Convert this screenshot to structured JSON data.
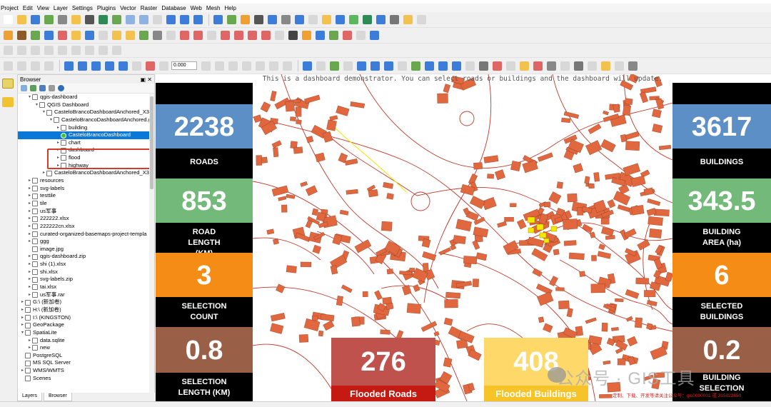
{
  "menu": [
    "Project",
    "Edit",
    "View",
    "Layer",
    "Settings",
    "Plugins",
    "Vector",
    "Raster",
    "Database",
    "Web",
    "Mesh",
    "Help"
  ],
  "toolbar": {
    "scale_value": "0.000"
  },
  "browser": {
    "title": "Browser",
    "tabs": [
      "Layers",
      "Browser"
    ],
    "tree": [
      {
        "label": "qgis-dashboard",
        "depth": 1,
        "arrow": "▾"
      },
      {
        "label": "QGIS Dashboard",
        "depth": 2,
        "arrow": "▾"
      },
      {
        "label": "CasteloBrancoDashboardAnchored_X3U",
        "depth": 3,
        "arrow": "▾"
      },
      {
        "label": "CasteloBrancoDashboardAnchored.g",
        "depth": 4,
        "arrow": "▾"
      },
      {
        "label": "building",
        "depth": 5,
        "arrow": "▸"
      },
      {
        "label": "CasteloBrancoDashboard",
        "depth": 5,
        "arrow": "",
        "selected": true
      },
      {
        "label": "chart",
        "depth": 5,
        "arrow": "▸"
      },
      {
        "label": "dashboard",
        "depth": 5,
        "arrow": "▸"
      },
      {
        "label": "flood",
        "depth": 5,
        "arrow": "▸"
      },
      {
        "label": "highway",
        "depth": 5,
        "arrow": "▸"
      },
      {
        "label": "CasteloBrancoDashboardAnchored_X3U",
        "depth": 3,
        "arrow": "▸"
      },
      {
        "label": "resources",
        "depth": 1,
        "arrow": "▸"
      },
      {
        "label": "svg-labels",
        "depth": 1,
        "arrow": "▸"
      },
      {
        "label": "testtile",
        "depth": 1,
        "arrow": "▸"
      },
      {
        "label": "tile",
        "depth": 1,
        "arrow": "▸"
      },
      {
        "label": "us军事",
        "depth": 1,
        "arrow": "▸"
      },
      {
        "label": "222222.xlsx",
        "depth": 1,
        "arrow": "▸"
      },
      {
        "label": "222222cn.xlsx",
        "depth": 1,
        "arrow": "▸"
      },
      {
        "label": "curated-organized-basemaps-project-templa",
        "depth": 1,
        "arrow": "▸"
      },
      {
        "label": "ggg",
        "depth": 1,
        "arrow": "▸"
      },
      {
        "label": "image.jpg",
        "depth": 1,
        "arrow": ""
      },
      {
        "label": "qgis-dashboard.zip",
        "depth": 1,
        "arrow": "▸"
      },
      {
        "label": "shi (1).xlsx",
        "depth": 1,
        "arrow": "▸"
      },
      {
        "label": "shi.xlsx",
        "depth": 1,
        "arrow": "▸"
      },
      {
        "label": "svg-labels.zip",
        "depth": 1,
        "arrow": "▸"
      },
      {
        "label": "tai.xlsx",
        "depth": 1,
        "arrow": "▸"
      },
      {
        "label": "us军事.rar",
        "depth": 1,
        "arrow": "▸"
      },
      {
        "label": "G:\\ (新加卷)",
        "depth": 0,
        "arrow": "▸"
      },
      {
        "label": "H:\\ (新加卷)",
        "depth": 0,
        "arrow": "▸"
      },
      {
        "label": "I:\\ (KINGSTON)",
        "depth": 0,
        "arrow": "▸"
      },
      {
        "label": "GeoPackage",
        "depth": 0,
        "arrow": "▸"
      },
      {
        "label": "SpatiaLite",
        "depth": 0,
        "arrow": "▾"
      },
      {
        "label": "data.sqlite",
        "depth": 1,
        "arrow": "▸"
      },
      {
        "label": "new",
        "depth": 1,
        "arrow": "▸"
      },
      {
        "label": "PostgreSQL",
        "depth": 0,
        "arrow": ""
      },
      {
        "label": "MS SQL Server",
        "depth": 0,
        "arrow": ""
      },
      {
        "label": "WMS/WMTS",
        "depth": 0,
        "arrow": "▸"
      },
      {
        "label": "Scenes",
        "depth": 0,
        "arrow": ""
      }
    ]
  },
  "dashboard": {
    "banner": "This is a dashboard demonstrator. You can select roads or buildings and the dashboard will update.",
    "left": [
      {
        "value": "2238",
        "label": "ROADS",
        "color": "#5b8fc5"
      },
      {
        "value": "853",
        "label": "ROAD LENGTH (KM)",
        "color": "#72b97a"
      },
      {
        "value": "3",
        "label": "SELECTION COUNT",
        "color": "#f58c16"
      },
      {
        "value": "0.8",
        "label": "SELECTION LENGTH (KM)",
        "color": "#9a6047"
      }
    ],
    "right": [
      {
        "value": "3617",
        "label": "BUILDINGS",
        "color": "#5b8fc5"
      },
      {
        "value": "343.5",
        "label": "BUILDING AREA (ha)",
        "color": "#72b97a"
      },
      {
        "value": "6",
        "label": "SELECTED BUILDINGS",
        "color": "#f58c16"
      },
      {
        "value": "0.2",
        "label": "BUILDING SELECTION",
        "color": "#9a6047"
      }
    ],
    "bottom": [
      {
        "value": "276",
        "label": "Flooded Roads",
        "color": "#c0524e",
        "label_bg": "#c41a12"
      },
      {
        "value": "408",
        "label": "Flooded Buildings",
        "color": "#ffd86a",
        "label_bg": "#f6c328"
      }
    ]
  },
  "watermark": {
    "text": "公众号 · GIS工具",
    "sub": "定制、下载、开发等请关注公众号：gis0000001 或 315022850"
  },
  "colors": {
    "building": "#e1673e",
    "road": "#c0392b",
    "selected": "#f3e800"
  }
}
